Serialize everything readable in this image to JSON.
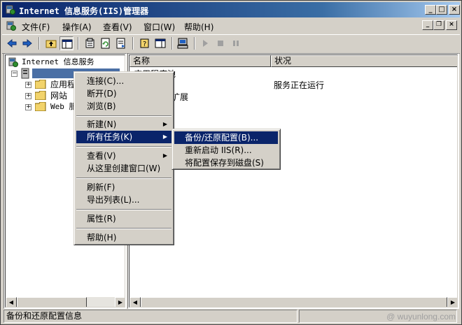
{
  "window": {
    "title": "Internet 信息服务(IIS)管理器",
    "controls": {
      "minimize": "_",
      "maximize": "□",
      "close": "×"
    }
  },
  "menubar": {
    "items": [
      "文件(F)",
      "操作(A)",
      "查看(V)",
      "窗口(W)",
      "帮助(H)"
    ],
    "mdi_controls": {
      "minimize": "_",
      "restore": "❐",
      "close": "×"
    }
  },
  "tree": {
    "root": "Internet 信息服务",
    "server": "",
    "children": [
      "应用程",
      "网站",
      "Web 服"
    ]
  },
  "list": {
    "columns": [
      "名称",
      "状况"
    ],
    "rows": [
      {
        "name": "应用程序池",
        "status": ""
      },
      {
        "name": "",
        "status": "服务正在运行"
      },
      {
        "name": "务扩展",
        "status": ""
      }
    ]
  },
  "context_menu": {
    "groups": [
      [
        "连接(C)...",
        "断开(D)",
        "浏览(B)"
      ],
      [
        "新建(N)",
        "所有任务(K)"
      ],
      [
        "查看(V)",
        "从这里创建窗口(W)"
      ],
      [
        "刷新(F)",
        "导出列表(L)..."
      ],
      [
        "属性(R)"
      ],
      [
        "帮助(H)"
      ]
    ],
    "highlighted": "所有任务(K)"
  },
  "submenu": {
    "items": [
      "备份/还原配置(B)...",
      "重新启动 IIS(R)...",
      "将配置保存到磁盘(S)"
    ],
    "highlighted": "备份/还原配置(B)..."
  },
  "statusbar": {
    "text": "备份和还原配置信息"
  },
  "watermark": "@ wuyunlong.com",
  "colors": {
    "title_start": "#0a246a",
    "title_end": "#a6caf0",
    "highlight": "#0a246a",
    "face": "#d4d0c8",
    "folder": "#f2d36b"
  }
}
